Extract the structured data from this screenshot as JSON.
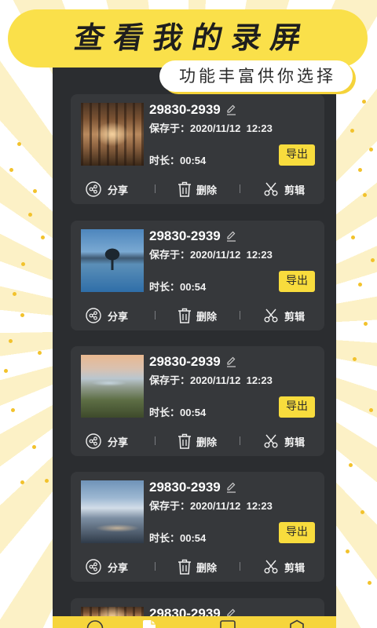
{
  "banner": {
    "title": "查看我的录屏",
    "subtitle": "功能丰富供你选择"
  },
  "labels": {
    "saved": "保存于：",
    "duration": "时长：",
    "export": "导出",
    "share": "分享",
    "delete": "删除",
    "edit": "剪辑"
  },
  "recordings": [
    {
      "name": "29830-2939",
      "saved_at": "2020/11/12  12:23",
      "duration": "00:54"
    },
    {
      "name": "29830-2939",
      "saved_at": "2020/11/12  12:23",
      "duration": "00:54"
    },
    {
      "name": "29830-2939",
      "saved_at": "2020/11/12  12:23",
      "duration": "00:54"
    },
    {
      "name": "29830-2939",
      "saved_at": "2020/11/12  12:23",
      "duration": "00:54"
    },
    {
      "name": "29830-2939"
    }
  ],
  "icons": {
    "rename": "pencil-icon",
    "share": "share-icon",
    "delete": "trash-icon",
    "edit": "scissors-icon",
    "nav": [
      "circle-icon",
      "file-icon",
      "square-icon",
      "hexagon-icon"
    ]
  },
  "colors": {
    "accent": "#f8dc3d",
    "banner": "#fae04a",
    "panel": "#2b2d30",
    "card": "#36383b"
  }
}
